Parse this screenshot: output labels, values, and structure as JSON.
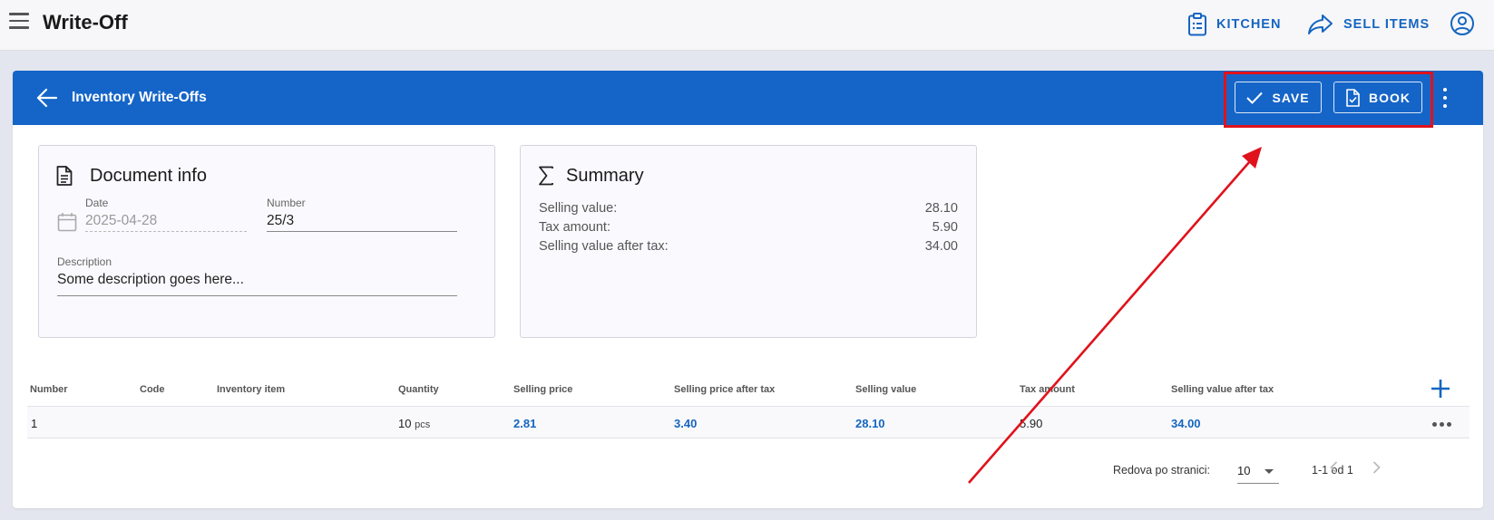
{
  "app": {
    "title": "Write-Off",
    "actions": [
      {
        "label": "KITCHEN",
        "icon": "clipboard-list-icon"
      },
      {
        "label": "SELL ITEMS",
        "icon": "share-arrow-icon"
      }
    ],
    "account_icon": "account-circle-icon"
  },
  "header": {
    "title": "Inventory Write-Offs",
    "save_label": "SAVE",
    "book_label": "BOOK",
    "color": "#1565c8"
  },
  "document_info": {
    "title": "Document info",
    "date_label": "Date",
    "date_value": "2025-04-28",
    "number_label": "Number",
    "number_value": "25/3",
    "description_label": "Description",
    "description_value": "Some description goes here..."
  },
  "summary": {
    "title": "Summary",
    "rows": [
      {
        "label": "Selling value:",
        "value": "28.10"
      },
      {
        "label": "Tax amount:",
        "value": "5.90"
      },
      {
        "label": "Selling value after tax:",
        "value": "34.00"
      }
    ]
  },
  "table": {
    "columns": [
      "Number",
      "Code",
      "Inventory item",
      "Quantity",
      "Selling price",
      "Selling price after tax",
      "Selling value",
      "Tax amount",
      "Selling value after tax"
    ],
    "rows": [
      {
        "number": "1",
        "code": "",
        "item": "",
        "quantity": "10",
        "unit": "pcs",
        "selling_price": "2.81",
        "selling_price_after_tax": "3.40",
        "selling_value": "28.10",
        "tax_amount": "5.90",
        "selling_value_after_tax": "34.00"
      }
    ]
  },
  "pagination": {
    "rows_per_page_label": "Redova po stranici:",
    "rows_per_page": "10",
    "range": "1-1 od 1"
  },
  "colors": {
    "accent": "#1565c0",
    "annotation": "#e0121b"
  }
}
